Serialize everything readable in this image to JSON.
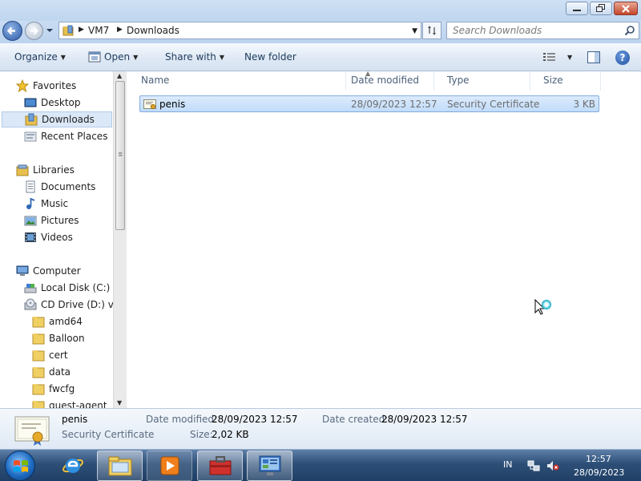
{
  "window": {
    "minimize_icon": "minimize-icon",
    "maximize_icon": "restore-icon",
    "close_icon": "close-icon"
  },
  "address": {
    "path": [
      "VM7",
      "Downloads"
    ],
    "search_placeholder": "Search Downloads"
  },
  "toolbar": {
    "organize_label": "Organize",
    "open_label": "Open",
    "share_label": "Share with",
    "new_folder_label": "New folder"
  },
  "nav": {
    "favorites": "Favorites",
    "desktop": "Desktop",
    "downloads": "Downloads",
    "recent": "Recent Places",
    "libraries": "Libraries",
    "documents": "Documents",
    "music": "Music",
    "pictures": "Pictures",
    "videos": "Videos",
    "computer": "Computer",
    "local_disk": "Local Disk (C:)",
    "cd_drive": "CD Drive (D:) virt",
    "amd64": "amd64",
    "balloon": "Balloon",
    "cert": "cert",
    "data": "data",
    "fwcfg": "fwcfg",
    "guest_agent": "guest-agent",
    "selected": "Downloads"
  },
  "columns": {
    "name": "Name",
    "date": "Date modified",
    "type": "Type",
    "size": "Size"
  },
  "files": [
    {
      "name": "penis",
      "date": "28/09/2023 12:57",
      "type": "Security Certificate",
      "size": "3 KB"
    }
  ],
  "details": {
    "name": "penis",
    "type": "Security Certificate",
    "date_modified_label": "Date modified:",
    "date_modified": "28/09/2023 12:57",
    "date_created_label": "Date created:",
    "date_created": "28/09/2023 12:57",
    "size_label": "Size:",
    "size": "2,02 KB"
  },
  "taskbar": {
    "language": "IN",
    "time": "12:57",
    "date": "28/09/2023"
  },
  "colors": {
    "selection": "#cce4ff",
    "taskbar": "#2d4f77"
  }
}
